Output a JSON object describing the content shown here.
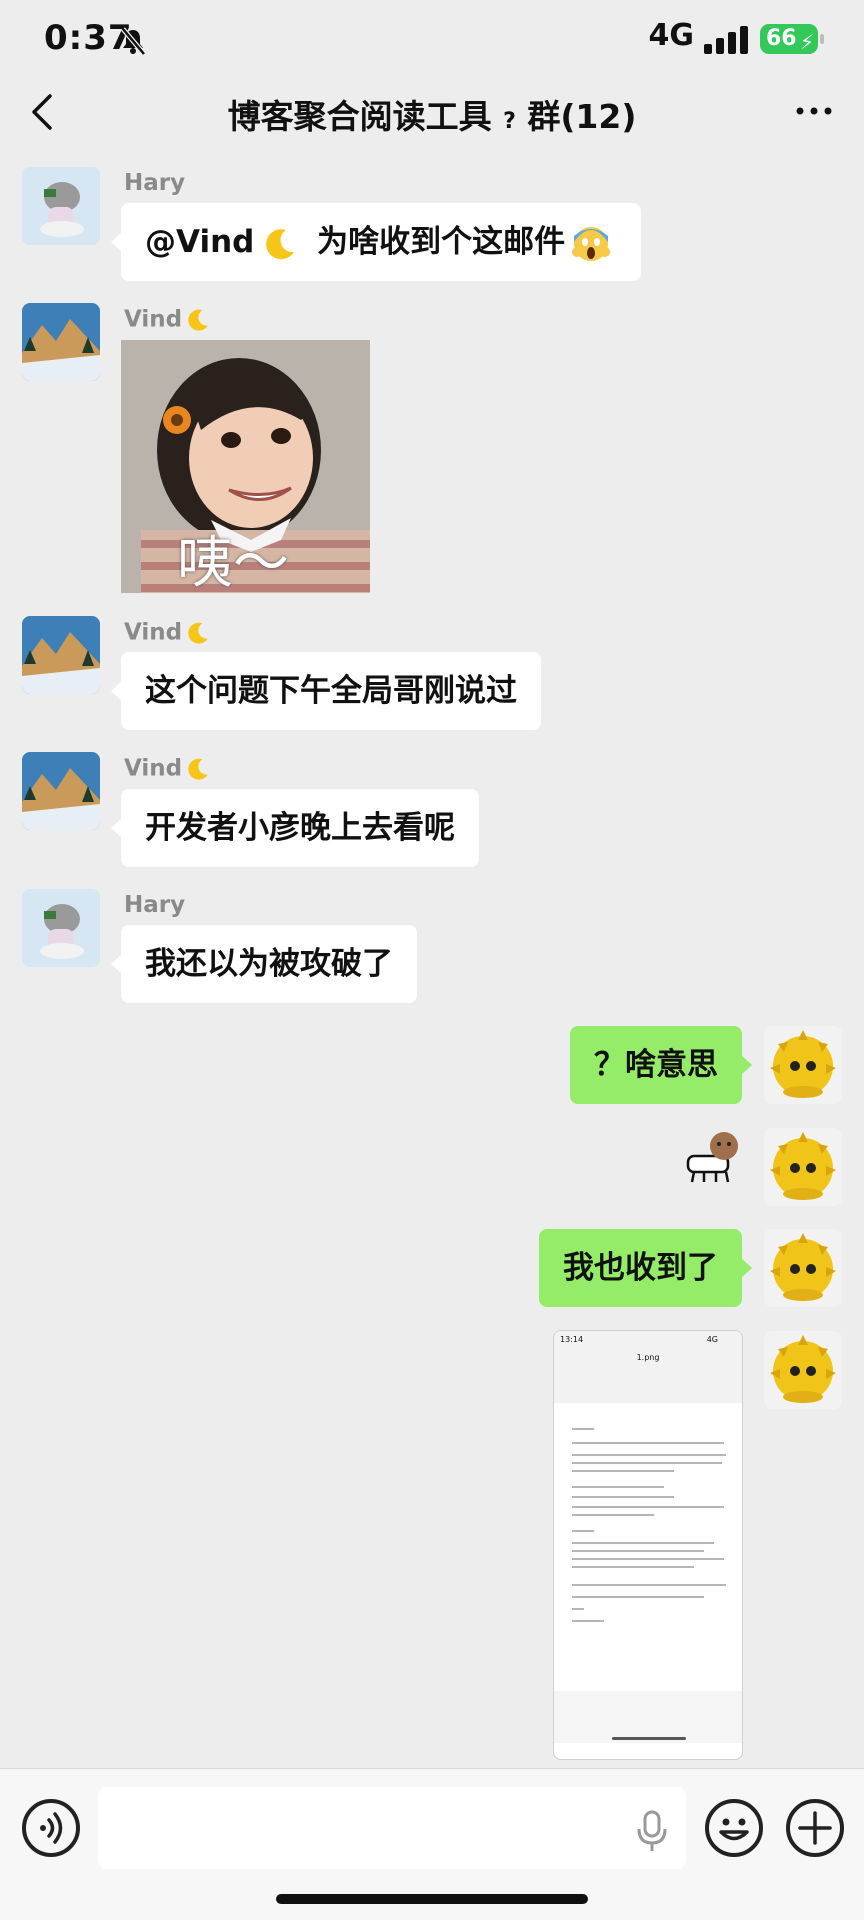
{
  "status_bar": {
    "time": "0:37",
    "network": "4G",
    "battery": "66"
  },
  "header": {
    "title": "博客聚合阅读工具",
    "title_q": "?",
    "title_suffix": "群(12)"
  },
  "messages": [
    {
      "sender": "Hary",
      "avatar": "cat-avatar",
      "text_a": "@Vind",
      "text_b": " 为啥收到个这邮件"
    },
    {
      "sender": "Vind",
      "avatar": "mountain-avatar",
      "sticker_caption": "咦～"
    },
    {
      "sender": "Vind",
      "avatar": "mountain-avatar",
      "text": "这个问题下午全局哥刚说过"
    },
    {
      "sender": "Vind",
      "avatar": "mountain-avatar",
      "text": "开发者小彦晚上去看呢"
    },
    {
      "sender": "Hary",
      "avatar": "cat-avatar",
      "text": "我还以为被攻破了"
    },
    {
      "sender": "me",
      "avatar": "durian-avatar",
      "text": "？啥意思"
    },
    {
      "sender": "me",
      "avatar": "durian-avatar",
      "sticker": "dog-sticker"
    },
    {
      "sender": "me",
      "avatar": "durian-avatar",
      "text": "我也收到了"
    },
    {
      "sender": "me",
      "avatar": "durian-avatar",
      "screenshot": {
        "time": "13:14",
        "name": "1.png",
        "network": "4G"
      }
    }
  ],
  "input_bar": {
    "left_icon": "voice-icon",
    "mic_icon": "mic-icon",
    "emoji_icon": "emoji-icon",
    "plus_icon": "plus-icon"
  }
}
